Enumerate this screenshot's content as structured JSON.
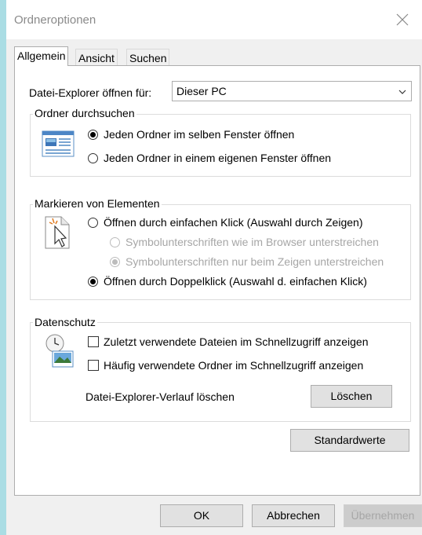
{
  "window": {
    "title": "Ordneroptionen",
    "close_icon": "close-icon"
  },
  "tabs": [
    {
      "label": "Allgemein",
      "active": true
    },
    {
      "label": "Ansicht",
      "active": false
    },
    {
      "label": "Suchen",
      "active": false
    }
  ],
  "general": {
    "open_label": "Datei-Explorer öffnen für:",
    "open_value": "Dieser PC",
    "browse": {
      "legend": "Ordner durchsuchen",
      "option_same": "Jeden Ordner im selben Fenster öffnen",
      "option_new": "Jeden Ordner in einem eigenen Fenster öffnen",
      "selected": "same"
    },
    "click": {
      "legend": "Markieren von Elementen",
      "option_single": "Öffnen durch einfachen Klick (Auswahl durch Zeigen)",
      "sub_browser": "Symbolunterschriften wie im Browser unterstreichen",
      "sub_point": "Symbolunterschriften nur beim Zeigen unterstreichen",
      "option_double": "Öffnen durch Doppelklick (Auswahl d. einfachen Klick)",
      "selected": "double"
    },
    "privacy": {
      "legend": "Datenschutz",
      "recent_files": "Zuletzt verwendete Dateien im Schnellzugriff anzeigen",
      "frequent_folders": "Häufig verwendete Ordner im Schnellzugriff anzeigen",
      "recent_checked": false,
      "frequent_checked": false,
      "clear_label": "Datei-Explorer-Verlauf löschen",
      "clear_button": "Löschen"
    },
    "restore_defaults": "Standardwerte"
  },
  "footer": {
    "ok": "OK",
    "cancel": "Abbrechen",
    "apply": "Übernehmen"
  },
  "colors": {
    "background": "#aadde4",
    "dialog": "#f0f0f0",
    "panel": "#ffffff",
    "disabled_text": "#a6a6a6"
  }
}
